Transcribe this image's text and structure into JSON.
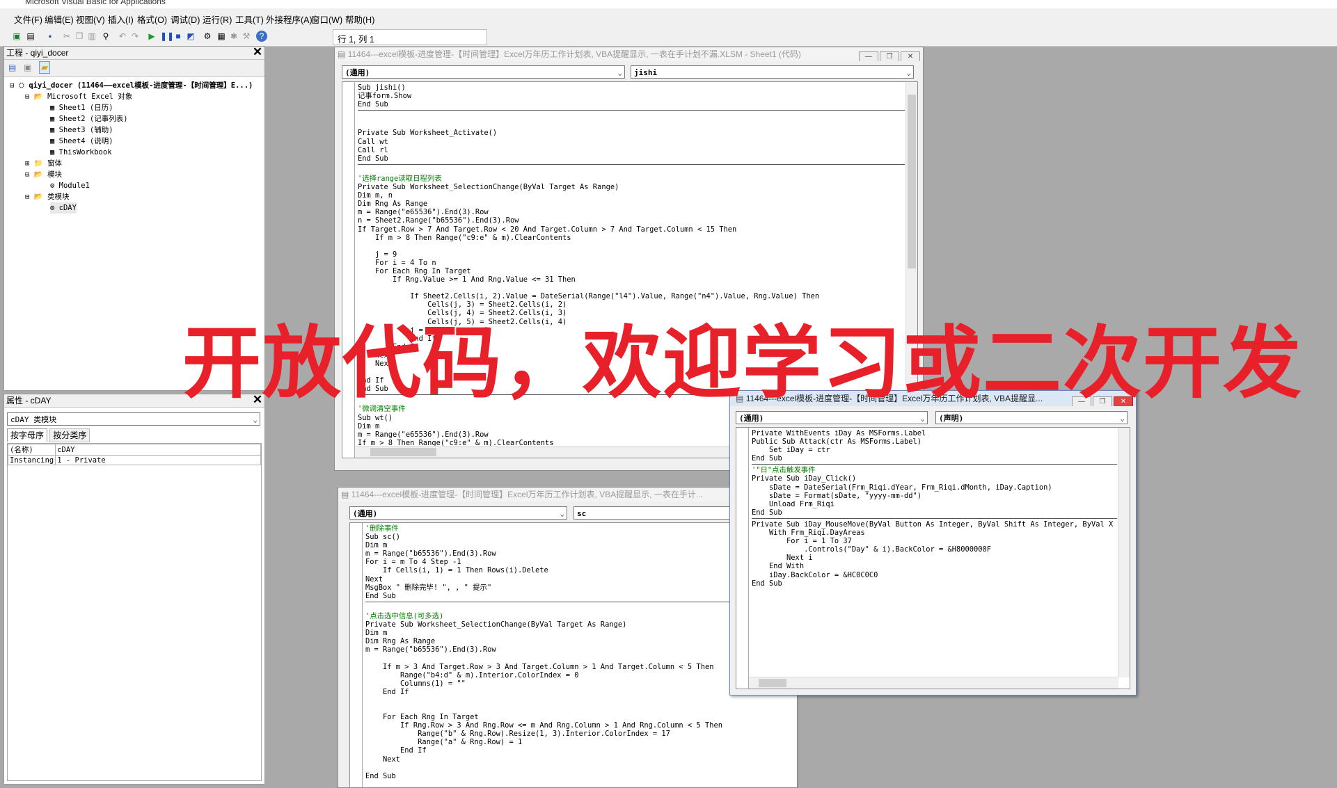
{
  "app_title": "Microsoft Visual Basic for Applications",
  "menu": [
    "文件(F)",
    "编辑(E)",
    "视图(V)",
    "插入(I)",
    "格式(O)",
    "调试(D)",
    "运行(R)",
    "工具(T)",
    "外接程序(A)",
    "窗口(W)",
    "帮助(H)"
  ],
  "toolbar": {
    "position": "行 1, 列 1",
    "help_glyph": "?"
  },
  "project_panel": {
    "title": "工程 - qiyi_docer",
    "close": "✕",
    "tree": [
      {
        "label": "qiyi_docer (11464——excel模板-进度管理-【时间管理】E...)",
        "icon": "⛭",
        "expander": "⊟"
      },
      {
        "label": "Microsoft Excel 对象",
        "icon": "📂",
        "expander": "⊟"
      },
      {
        "label": "Sheet1 (日历)",
        "icon": "▦",
        "expander": ""
      },
      {
        "label": "Sheet2 (记事列表)",
        "icon": "▦",
        "expander": ""
      },
      {
        "label": "Sheet3 (辅助)",
        "icon": "▦",
        "expander": ""
      },
      {
        "label": "Sheet4 (说明)",
        "icon": "▦",
        "expander": ""
      },
      {
        "label": "ThisWorkbook",
        "icon": "▦",
        "expander": ""
      },
      {
        "label": "窗体",
        "icon": "📁",
        "expander": "⊞"
      },
      {
        "label": "模块",
        "icon": "📂",
        "expander": "⊟"
      },
      {
        "label": "Module1",
        "icon": "⚙",
        "expander": ""
      },
      {
        "label": "类模块",
        "icon": "📂",
        "expander": "⊟"
      },
      {
        "label": "cDAY",
        "icon": "⚙",
        "expander": ""
      }
    ]
  },
  "properties_panel": {
    "title": "属性 - cDAY",
    "close": "✕",
    "object_combo": "cDAY 类模块",
    "tabs": [
      "按字母序",
      "按分类序"
    ],
    "rows": [
      {
        "name": "(名称)",
        "value": "cDAY"
      },
      {
        "name": "Instancing",
        "value": "1 - Private"
      }
    ]
  },
  "win1": {
    "title": "11464---excel模板-进度管理-【时间管理】Excel万年历工作计划表, VBA提醒显示, 一表在手计划不漏.XLSM - Sheet1 (代码)",
    "combo_left": "(通用)",
    "combo_right": "jishi",
    "code": [
      "Sub jishi()\n记事form.Show\nEnd Sub",
      "\n\nPrivate Sub Worksheet_Activate()\nCall wt\nCall rl\nEnd Sub",
      "\n'选择range读取日程列表\nPrivate Sub Worksheet_SelectionChange(ByVal Target As Range)\nDim m, n\nDim Rng As Range\nm = Range(\"e65536\").End(3).Row\nn = Sheet2.Range(\"b65536\").End(3).Row\nIf Target.Row > 7 And Target.Row < 20 And Target.Column > 7 And Target.Column < 15 Then\n    If m > 8 Then Range(\"c9:e\" & m).ClearContents\n\n    j = 9\n    For i = 4 To n\n    For Each Rng In Target\n        If Rng.Value >= 1 And Rng.Value <= 31 Then\n\n            If Sheet2.Cells(i, 2).Value = DateSerial(Range(\"l4\").Value, Range(\"n4\").Value, Rng.Value) Then\n                Cells(j, 3) = Sheet2.Cells(i, 2)\n                Cells(j, 4) = Sheet2.Cells(i, 3)\n                Cells(j, 5) = Sheet2.Cells(i, 4)\n            j = j + 1\n            End If\n        End If\n    Next\n    Next\n\nEnd If\nEnd Sub",
      "\n'微调清空事件\nSub wt()\nDim m\nm = Range(\"e65536\").End(3).Row\nIf m > 8 Then Range(\"c9:e\" & m).ClearContents\nCall rl"
    ]
  },
  "win2": {
    "title": "11464---excel模板-进度管理-【时间管理】Excel万年历工作计划表, VBA提醒显示, 一表在手计...",
    "combo_left": "(通用)",
    "combo_right": "sc",
    "code": [
      "'删除事件\nSub sc()\nDim m\nm = Range(\"b65536\").End(3).Row\nFor i = m To 4 Step -1\n    If Cells(i, 1) = 1 Then Rows(i).Delete\nNext\nMsgBox \" 删除完毕! \", , \" 提示\"\nEnd Sub",
      "\n'点击选中信息(可多选)\nPrivate Sub Worksheet_SelectionChange(ByVal Target As Range)\nDim m\nDim Rng As Range\nm = Range(\"b65536\").End(3).Row\n\n    If m > 3 And Target.Row > 3 And Target.Column > 1 And Target.Column < 5 Then\n        Range(\"b4:d\" & m).Interior.ColorIndex = 0\n        Columns(1) = \"\"\n    End If\n\n\n    For Each Rng In Target\n        If Rng.Row > 3 And Rng.Row <= m And Rng.Column > 1 And Rng.Column < 5 Then\n            Range(\"b\" & Rng.Row).Resize(1, 3).Interior.ColorIndex = 17\n            Range(\"a\" & Rng.Row) = 1\n        End If\n    Next\n\nEnd Sub"
    ]
  },
  "win3": {
    "title": "11464---excel模板-进度管理-【时间管理】Excel万年历工作计划表, VBA提醒显...",
    "combo_left": "(通用)",
    "combo_right": "(声明)",
    "code": [
      "Private WithEvents iDay As MSForms.Label\nPublic Sub Attack(ctr As MSForms.Label)\n    Set iDay = ctr\nEnd Sub",
      "'\"日\"点击触发事件\nPrivate Sub iDay_Click()\n    sDate = DateSerial(Frm_Riqi.dYear, Frm_Riqi.dMonth, iDay.Caption)\n    sDate = Format(sDate, \"yyyy-mm-dd\")\n    Unload Frm_Riqi\nEnd Sub",
      "Private Sub iDay_MouseMove(ByVal Button As Integer, ByVal Shift As Integer, ByVal X As\n    With Frm_Riqi.DayAreas\n        For i = 1 To 37\n            .Controls(\"Day\" & i).BackColor = &H8000000F\n        Next i\n    End With\n    iDay.BackColor = &HC0C0C0\nEnd Sub"
    ]
  },
  "overlay_text": "开放代码，欢迎学习或二次开发",
  "colors": {
    "overlay": "#e8202a",
    "comment": "#008000",
    "mdi_bg": "#a9a9a9"
  }
}
